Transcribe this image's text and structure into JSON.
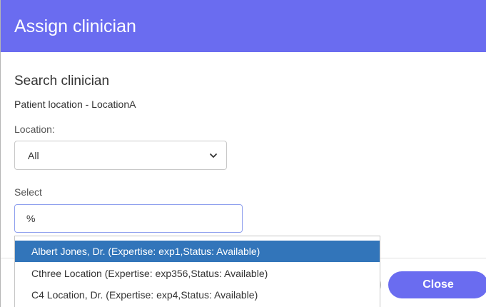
{
  "dialog": {
    "title": "Assign clinician"
  },
  "search": {
    "section_title": "Search clinician",
    "patient_location": "Patient location - LocationA",
    "location_label": "Location:",
    "location_value": "All",
    "select_label": "Select",
    "query_value": "%"
  },
  "results": [
    {
      "label": "Albert Jones, Dr. (Expertise: exp1,Status: Available)",
      "selected": true
    },
    {
      "label": "Cthree Location (Expertise: exp356,Status: Available)",
      "selected": false
    },
    {
      "label": "C4 Location, Dr. (Expertise: exp4,Status: Available)",
      "selected": false
    }
  ],
  "footer": {
    "close_label": "Close"
  },
  "colors": {
    "header": "#6a6cf0",
    "selected_item": "#3275ba",
    "button": "#6a6cf0"
  },
  "icons": {
    "location_dropdown": "chevron-down-icon"
  }
}
